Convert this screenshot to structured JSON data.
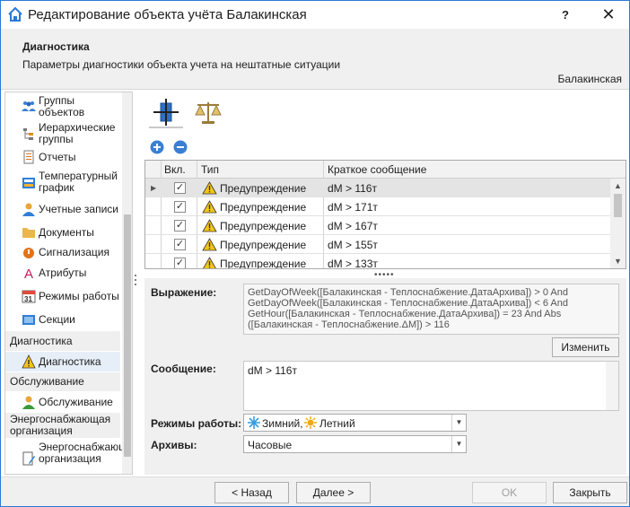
{
  "window": {
    "title": "Редактирование объекта учёта Балакинская",
    "help": "?",
    "close": "✕"
  },
  "header": {
    "title": "Диагностика",
    "subtitle": "Параметры диагностики объекта учета на нештатные ситуации",
    "object": "Балакинская"
  },
  "sidebar": {
    "items": [
      {
        "label": "Группы объектов",
        "icon": "people-group-icon"
      },
      {
        "label": "Иерархические группы",
        "icon": "hierarchy-icon"
      },
      {
        "label": "Отчеты",
        "icon": "report-icon"
      },
      {
        "label": "Температурный график",
        "icon": "temperature-chart-icon"
      },
      {
        "label": "Учетные записи",
        "icon": "user-icon"
      },
      {
        "label": "Документы",
        "icon": "folder-icon"
      },
      {
        "label": "Сигнализация",
        "icon": "alarm-icon"
      },
      {
        "label": "Атрибуты",
        "icon": "attribute-icon"
      },
      {
        "label": "Режимы работы",
        "icon": "calendar-icon"
      },
      {
        "label": "Секции",
        "icon": "section-icon"
      }
    ],
    "groups": {
      "diagnostics": "Диагностика",
      "diagnostics_item": "Диагностика",
      "service": "Обслуживание",
      "service_item": "Обслуживание",
      "energy": "Энергоснабжающая организация",
      "energy_item": "Энергоснабжающая организация"
    }
  },
  "grid": {
    "headers": {
      "enabled": "Вкл.",
      "type": "Тип",
      "message": "Краткое сообщение"
    },
    "rows": [
      {
        "enabled": true,
        "type": "Предупреждение",
        "message": "dM > 116т"
      },
      {
        "enabled": true,
        "type": "Предупреждение",
        "message": "dM > 171т"
      },
      {
        "enabled": true,
        "type": "Предупреждение",
        "message": "dM > 167т"
      },
      {
        "enabled": true,
        "type": "Предупреждение",
        "message": "dM > 155т"
      },
      {
        "enabled": true,
        "type": "Предупреждение",
        "message": "dM > 133т"
      }
    ],
    "selected_row": 0
  },
  "detail": {
    "expression_label": "Выражение:",
    "expression": "GetDayOfWeek([Балакинская - Теплоснабжение.ДатаАрхива]) > 0 And GetDayOfWeek([Балакинская - Теплоснабжение.ДатаАрхива]) < 6 And GetHour([Балакинская - Теплоснабжение.ДатаАрхива]) = 23 And Abs ([Балакинская - Теплоснабжение.ΔM]) > 116",
    "edit_button": "Изменить",
    "message_label": "Сообщение:",
    "message": "dM > 116т",
    "modes_label": "Режимы работы:",
    "modes_winter": "Зимний,",
    "modes_summer": "Летний",
    "archives_label": "Архивы:",
    "archives_value": "Часовые"
  },
  "footer": {
    "back": "< Назад",
    "next": "Далее >",
    "ok": "OK",
    "close": "Закрыть"
  },
  "colors": {
    "accent": "#2b79d8",
    "warning": "#f5c518",
    "tab_icon_blue": "#2f6fc4"
  }
}
